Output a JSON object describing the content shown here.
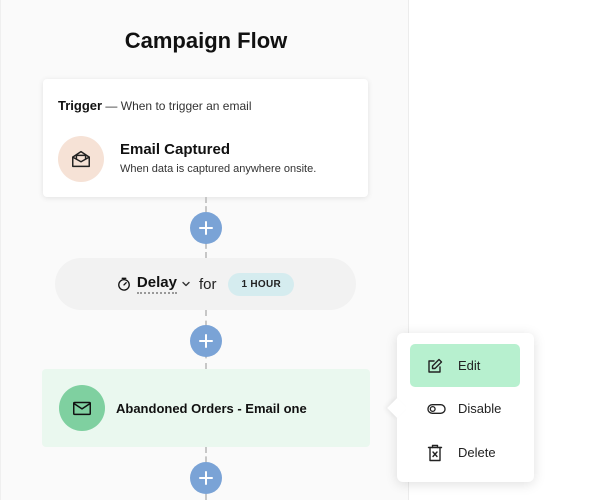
{
  "flow": {
    "title": "Campaign Flow",
    "trigger": {
      "label": "Trigger",
      "description": "— When to trigger an email",
      "event_title": "Email Captured",
      "event_description": "When data is captured anywhere onsite.",
      "icon": "envelope-open-icon"
    },
    "delay": {
      "label": "Delay",
      "connector_text": "for",
      "duration": "1 HOUR",
      "icon": "timer-icon"
    },
    "email_step": {
      "title": "Abandoned Orders - Email one",
      "icon": "envelope-icon"
    },
    "add_step_icon": "plus-icon"
  },
  "context_menu": {
    "items": [
      {
        "label": "Edit",
        "icon": "edit-icon",
        "active": true
      },
      {
        "label": "Disable",
        "icon": "toggle-icon",
        "active": false
      },
      {
        "label": "Delete",
        "icon": "trash-icon",
        "active": false
      }
    ]
  },
  "colors": {
    "plus_button": "#7aa3d6",
    "trigger_avatar": "#f6e2d6",
    "duration_badge": "#d5ecef",
    "email_card": "#eaf8ef",
    "email_avatar": "#7fd0a0",
    "menu_active": "#b7f0cf"
  }
}
